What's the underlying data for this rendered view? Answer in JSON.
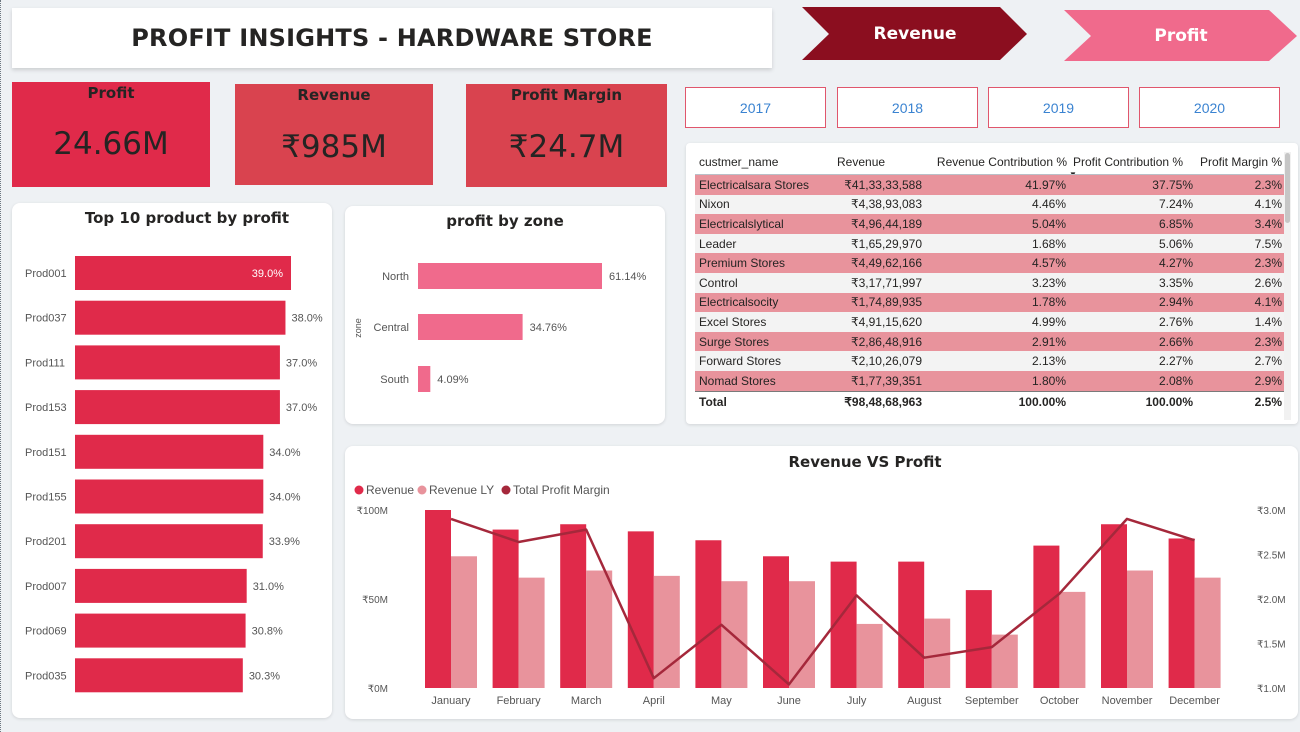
{
  "header": {
    "title": "PROFIT INSIGHTS - HARDWARE STORE"
  },
  "nav": {
    "revenue_label": "Revenue",
    "profit_label": "Profit"
  },
  "kpis": [
    {
      "label": "Profit",
      "value": "24.66M"
    },
    {
      "label": "Revenue",
      "value": "₹985M"
    },
    {
      "label": "Profit Margin",
      "value": "₹24.7M"
    }
  ],
  "years": [
    "2017",
    "2018",
    "2019",
    "2020"
  ],
  "colors": {
    "crimson": "#e02a4a",
    "pink": "#f06a8c",
    "dark_red": "#8b0e1f",
    "kpi_red": "#d9434f",
    "light_pink": "#e8939c",
    "margin_line": "#a5283b"
  },
  "top_products": {
    "title": "Top 10 product by profit",
    "chart_data": {
      "type": "bar",
      "orientation": "horizontal",
      "categories": [
        "Prod001",
        "Prod037",
        "Prod111",
        "Prod153",
        "Prod151",
        "Prod155",
        "Prod201",
        "Prod007",
        "Prod069",
        "Prod035"
      ],
      "values": [
        39.0,
        38.0,
        37.0,
        37.0,
        34.0,
        34.0,
        33.9,
        31.0,
        30.8,
        30.3
      ],
      "labels": [
        "39.0%",
        "38.0%",
        "37.0%",
        "37.0%",
        "34.0%",
        "34.0%",
        "33.9%",
        "31.0%",
        "30.8%",
        "30.3%"
      ]
    }
  },
  "zone": {
    "title": "profit by zone",
    "chart_data": {
      "type": "bar",
      "orientation": "horizontal",
      "ylabel": "zone",
      "categories": [
        "North",
        "Central",
        "South"
      ],
      "values": [
        61.14,
        34.76,
        4.09
      ],
      "labels": [
        "61.14%",
        "34.76%",
        "4.09%"
      ]
    }
  },
  "table": {
    "columns": [
      "custmer_name",
      "Revenue",
      "Revenue Contribution %",
      "Profit Contribution %",
      "Profit Margin %"
    ],
    "sort_icon": "sort-desc-icon",
    "rows": [
      [
        "Electricalsara Stores",
        "₹41,33,33,588",
        "41.97%",
        "37.75%",
        "2.3%"
      ],
      [
        "Nixon",
        "₹4,38,93,083",
        "4.46%",
        "7.24%",
        "4.1%"
      ],
      [
        "Electricalslytical",
        "₹4,96,44,189",
        "5.04%",
        "6.85%",
        "3.4%"
      ],
      [
        "Leader",
        "₹1,65,29,970",
        "1.68%",
        "5.06%",
        "7.5%"
      ],
      [
        "Premium Stores",
        "₹4,49,62,166",
        "4.57%",
        "4.27%",
        "2.3%"
      ],
      [
        "Control",
        "₹3,17,71,997",
        "3.23%",
        "3.35%",
        "2.6%"
      ],
      [
        "Electricalsocity",
        "₹1,74,89,935",
        "1.78%",
        "2.94%",
        "4.1%"
      ],
      [
        "Excel Stores",
        "₹4,91,15,620",
        "4.99%",
        "2.76%",
        "1.4%"
      ],
      [
        "Surge Stores",
        "₹2,86,48,916",
        "2.91%",
        "2.66%",
        "2.3%"
      ],
      [
        "Forward Stores",
        "₹2,10,26,079",
        "2.13%",
        "2.27%",
        "2.7%"
      ],
      [
        "Nomad Stores",
        "₹1,77,39,351",
        "1.80%",
        "2.08%",
        "2.9%"
      ]
    ],
    "total": [
      "Total",
      "₹98,48,68,963",
      "100.00%",
      "100.00%",
      "2.5%"
    ]
  },
  "combo": {
    "title": "Revenue VS Profit",
    "legend": [
      "Revenue",
      "Revenue LY",
      "Total Profit Margin"
    ],
    "chart_data": {
      "type": "bar",
      "categories": [
        "January",
        "February",
        "March",
        "April",
        "May",
        "June",
        "July",
        "August",
        "September",
        "October",
        "November",
        "December"
      ],
      "series": [
        {
          "name": "Revenue",
          "type": "bar",
          "axis": "left",
          "values": [
            100,
            89,
            92,
            88,
            83,
            74,
            71,
            71,
            55,
            80,
            92,
            84
          ]
        },
        {
          "name": "Revenue LY",
          "type": "bar",
          "axis": "left",
          "values": [
            74,
            62,
            66,
            63,
            60,
            60,
            36,
            39,
            30,
            54,
            66,
            62
          ]
        },
        {
          "name": "Total Profit Margin",
          "type": "line",
          "axis": "right",
          "values": [
            2.9,
            2.64,
            2.78,
            1.11,
            1.71,
            1.04,
            2.04,
            1.34,
            1.46,
            2.06,
            2.9,
            2.66
          ]
        }
      ],
      "ylim_left": [
        0,
        100
      ],
      "ylim_right": [
        1.0,
        3.0
      ],
      "left_ticks": [
        "₹100M",
        "₹50M",
        "₹0M"
      ],
      "right_ticks": [
        "₹3.0M",
        "₹2.5M",
        "₹2.0M",
        "₹1.5M",
        "₹1.0M"
      ]
    }
  }
}
